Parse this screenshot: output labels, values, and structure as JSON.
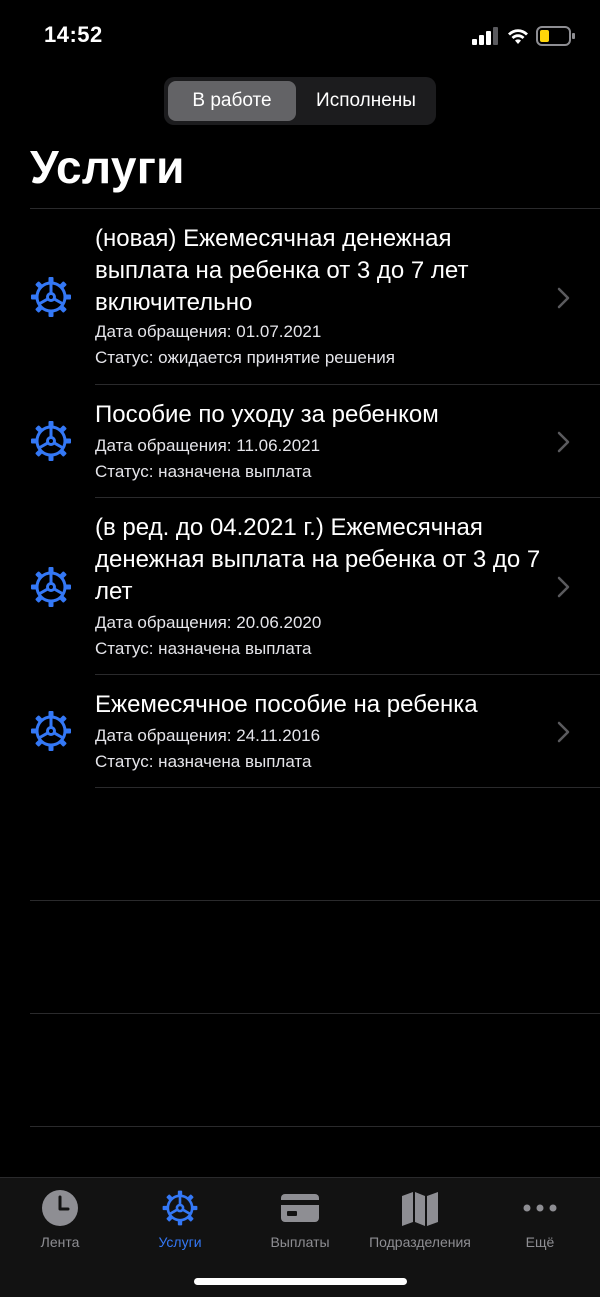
{
  "status": {
    "time": "14:52"
  },
  "segments": [
    {
      "label": "В работе",
      "active": true
    },
    {
      "label": "Исполнены",
      "active": false
    }
  ],
  "title": "Услуги",
  "services": [
    {
      "title": "(новая) Ежемесячная денежная выплата на ребенка от 3 до 7 лет включительно",
      "date": "Дата обращения: 01.07.2021",
      "status": "Статус: ожидается принятие решения",
      "icon": "gear-icon"
    },
    {
      "title": "Пособие по уходу за ребенком",
      "date": "Дата обращения: 11.06.2021",
      "status": "Статус: назначена выплата",
      "icon": "gear-icon"
    },
    {
      "title": "(в ред. до 04.2021 г.) Ежемесячная денежная выплата на ребенка от 3 до 7 лет",
      "date": "Дата обращения: 20.06.2020",
      "status": "Статус: назначена выплата",
      "icon": "gear-icon"
    },
    {
      "title": "Ежемесячное пособие на ребенка",
      "date": "Дата обращения: 24.11.2016",
      "status": "Статус: назначена выплата",
      "icon": "gear-icon"
    }
  ],
  "tabs": [
    {
      "label": "Лента",
      "icon": "clock-icon",
      "active": false
    },
    {
      "label": "Услуги",
      "icon": "gear-icon",
      "active": true
    },
    {
      "label": "Выплаты",
      "icon": "card-icon",
      "active": false
    },
    {
      "label": "Подразделения",
      "icon": "map-icon",
      "active": false
    },
    {
      "label": "Ещё",
      "icon": "more-icon",
      "active": false
    }
  ],
  "colors": {
    "accent": "#3478f6",
    "background": "#000000",
    "inactive_tab": "#8e8e93",
    "separator": "#2a2a2c"
  }
}
